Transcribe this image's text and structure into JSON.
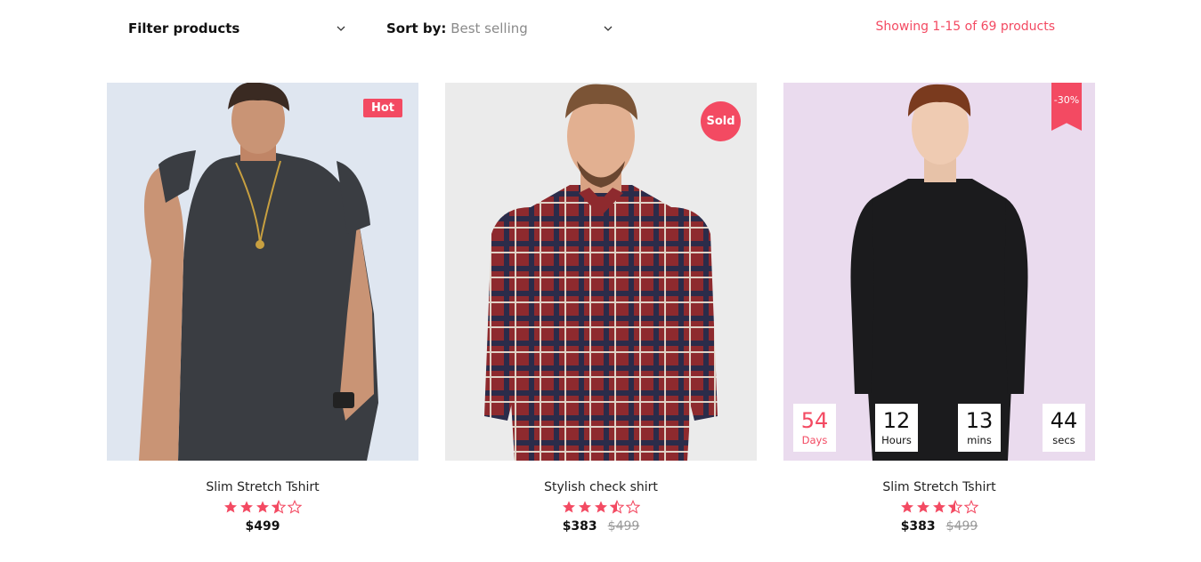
{
  "toolbar": {
    "filter_label": "Filter products",
    "sort_key": "Sort by:",
    "sort_value": "Best selling",
    "showing_text": "Showing 1-15 of 69 products"
  },
  "colors": {
    "accent": "#f34a62",
    "card1_bg": "#dfe6f0",
    "card2_bg": "#ebebeb",
    "card3_bg": "#eadbee"
  },
  "products": [
    {
      "name": "Slim Stretch Tshirt",
      "badge": "Hot",
      "rating": 3.5,
      "price": "$499",
      "old_price": ""
    },
    {
      "name": "Stylish check shirt",
      "badge": "Sold",
      "rating": 3.5,
      "price": "$383",
      "old_price": "$499"
    },
    {
      "name": "Slim Stretch Tshirt",
      "badge": "-30%",
      "rating": 3.5,
      "price": "$383",
      "old_price": "$499",
      "countdown": [
        {
          "value": "54",
          "label": "Days"
        },
        {
          "value": "12",
          "label": "Hours"
        },
        {
          "value": "13",
          "label": "mins"
        },
        {
          "value": "44",
          "label": "secs"
        }
      ]
    }
  ]
}
